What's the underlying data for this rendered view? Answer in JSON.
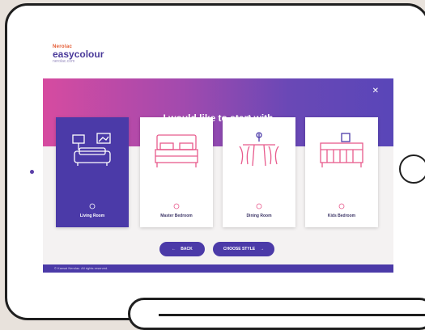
{
  "logo": {
    "line1": "Nerolac",
    "line2": "easycolour",
    "line3": "nerolac.com"
  },
  "hero": {
    "title": "I would like to start with",
    "close_label": "✕"
  },
  "cards": [
    {
      "name": "Living Room",
      "sub": "",
      "selected": true
    },
    {
      "name": "Master Bedroom",
      "sub": "",
      "selected": false
    },
    {
      "name": "Dining Room",
      "sub": "",
      "selected": false
    },
    {
      "name": "Kids Bedroom",
      "sub": "",
      "selected": false
    }
  ],
  "nav": {
    "back_label": "BACK",
    "back_icon": "←",
    "next_label": "CHOOSE STYLE",
    "next_icon": "→"
  },
  "footer": {
    "text": "© Kansai Nerolac. All rights reserved."
  },
  "colors": {
    "brand_purple": "#4b3aa8",
    "brand_pink": "#d64ba0",
    "logo_orange": "#e4572e",
    "icon_pink": "#e85a8c"
  }
}
